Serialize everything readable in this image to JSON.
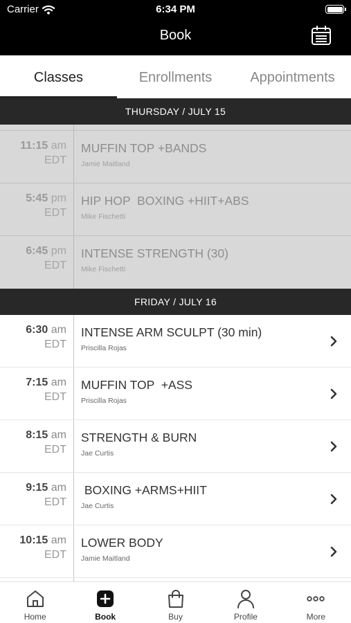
{
  "status_bar": {
    "carrier": "Carrier",
    "time": "6:34 PM"
  },
  "nav": {
    "title": "Book"
  },
  "tabs": [
    {
      "label": "Classes",
      "active": true
    },
    {
      "label": "Enrollments",
      "active": false
    },
    {
      "label": "Appointments",
      "active": false
    }
  ],
  "days": [
    {
      "header": "THURSDAY / JULY 15",
      "past": true,
      "classes": [
        {
          "time": "11:15",
          "ampm": "am",
          "tz": "EDT",
          "name": "MUFFIN TOP +BANDS",
          "instructor": "Jamie Maitland"
        },
        {
          "time": "5:45",
          "ampm": "pm",
          "tz": "EDT",
          "name": "HIP HOP  BOXING +HIIT+ABS",
          "instructor": "Mike Fischetti"
        },
        {
          "time": "6:45",
          "ampm": "pm",
          "tz": "EDT",
          "name": "INTENSE STRENGTH (30)",
          "instructor": "Mike Fischetti"
        }
      ]
    },
    {
      "header": "FRIDAY / JULY 16",
      "past": false,
      "classes": [
        {
          "time": "6:30",
          "ampm": "am",
          "tz": "EDT",
          "name": "INTENSE ARM SCULPT (30 min)",
          "instructor": "Priscilla Rojas"
        },
        {
          "time": "7:15",
          "ampm": "am",
          "tz": "EDT",
          "name": "MUFFIN TOP  +ASS",
          "instructor": "Priscilla Rojas"
        },
        {
          "time": "8:15",
          "ampm": "am",
          "tz": "EDT",
          "name": "STRENGTH & BURN",
          "instructor": "Jae Curtis"
        },
        {
          "time": "9:15",
          "ampm": "am",
          "tz": "EDT",
          "name": " BOXING +ARMS+HIIT",
          "instructor": "Jae Curtis"
        },
        {
          "time": "10:15",
          "ampm": "am",
          "tz": "EDT",
          "name": "LOWER BODY",
          "instructor": "Jamie Maitland"
        }
      ]
    }
  ],
  "tabbar": [
    {
      "label": "Home",
      "icon": "home-icon",
      "active": false
    },
    {
      "label": "Book",
      "icon": "plus-square-icon",
      "active": true
    },
    {
      "label": "Buy",
      "icon": "shopping-bag-icon",
      "active": false
    },
    {
      "label": "Profile",
      "icon": "person-icon",
      "active": false
    },
    {
      "label": "More",
      "icon": "more-dots-icon",
      "active": false
    }
  ]
}
